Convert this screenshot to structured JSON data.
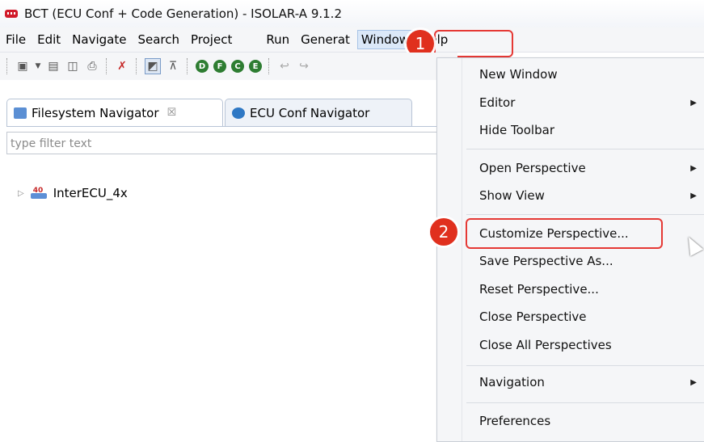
{
  "window": {
    "title": "BCT (ECU Conf + Code Generation) - ISOLAR-A 9.1.2"
  },
  "menubar": {
    "items": [
      "File",
      "Edit",
      "Navigate",
      "Search",
      "Project",
      "Run",
      "Generat",
      "Window",
      "Help"
    ],
    "active": "Window"
  },
  "toolbar": {
    "circle_letters": [
      "D",
      "F",
      "C",
      "E"
    ]
  },
  "tabs": {
    "filesystem": "Filesystem Navigator",
    "ecu_conf": "ECU Conf Navigator",
    "close_glyph": "☒"
  },
  "filter": {
    "placeholder": "type filter text"
  },
  "tree": {
    "project": "InterECU_4x",
    "project_badge": "40"
  },
  "window_menu": {
    "items": [
      {
        "label": "New Window",
        "submenu": false
      },
      {
        "label": "Editor",
        "submenu": true
      },
      {
        "label": "Hide Toolbar",
        "submenu": false
      },
      {
        "label": "Open Perspective",
        "submenu": true
      },
      {
        "label": "Show View",
        "submenu": true
      },
      {
        "label": "Customize Perspective...",
        "submenu": false
      },
      {
        "label": "Save Perspective As...",
        "submenu": false
      },
      {
        "label": "Reset Perspective...",
        "submenu": false
      },
      {
        "label": "Close Perspective",
        "submenu": false
      },
      {
        "label": "Close All Perspectives",
        "submenu": false
      },
      {
        "label": "Navigation",
        "submenu": true
      },
      {
        "label": "Preferences",
        "submenu": false
      }
    ]
  },
  "annotations": {
    "step1": "1",
    "step2": "2"
  },
  "colors": {
    "annotation_red": "#e0301e",
    "menu_highlight": "#dbe8f8"
  }
}
